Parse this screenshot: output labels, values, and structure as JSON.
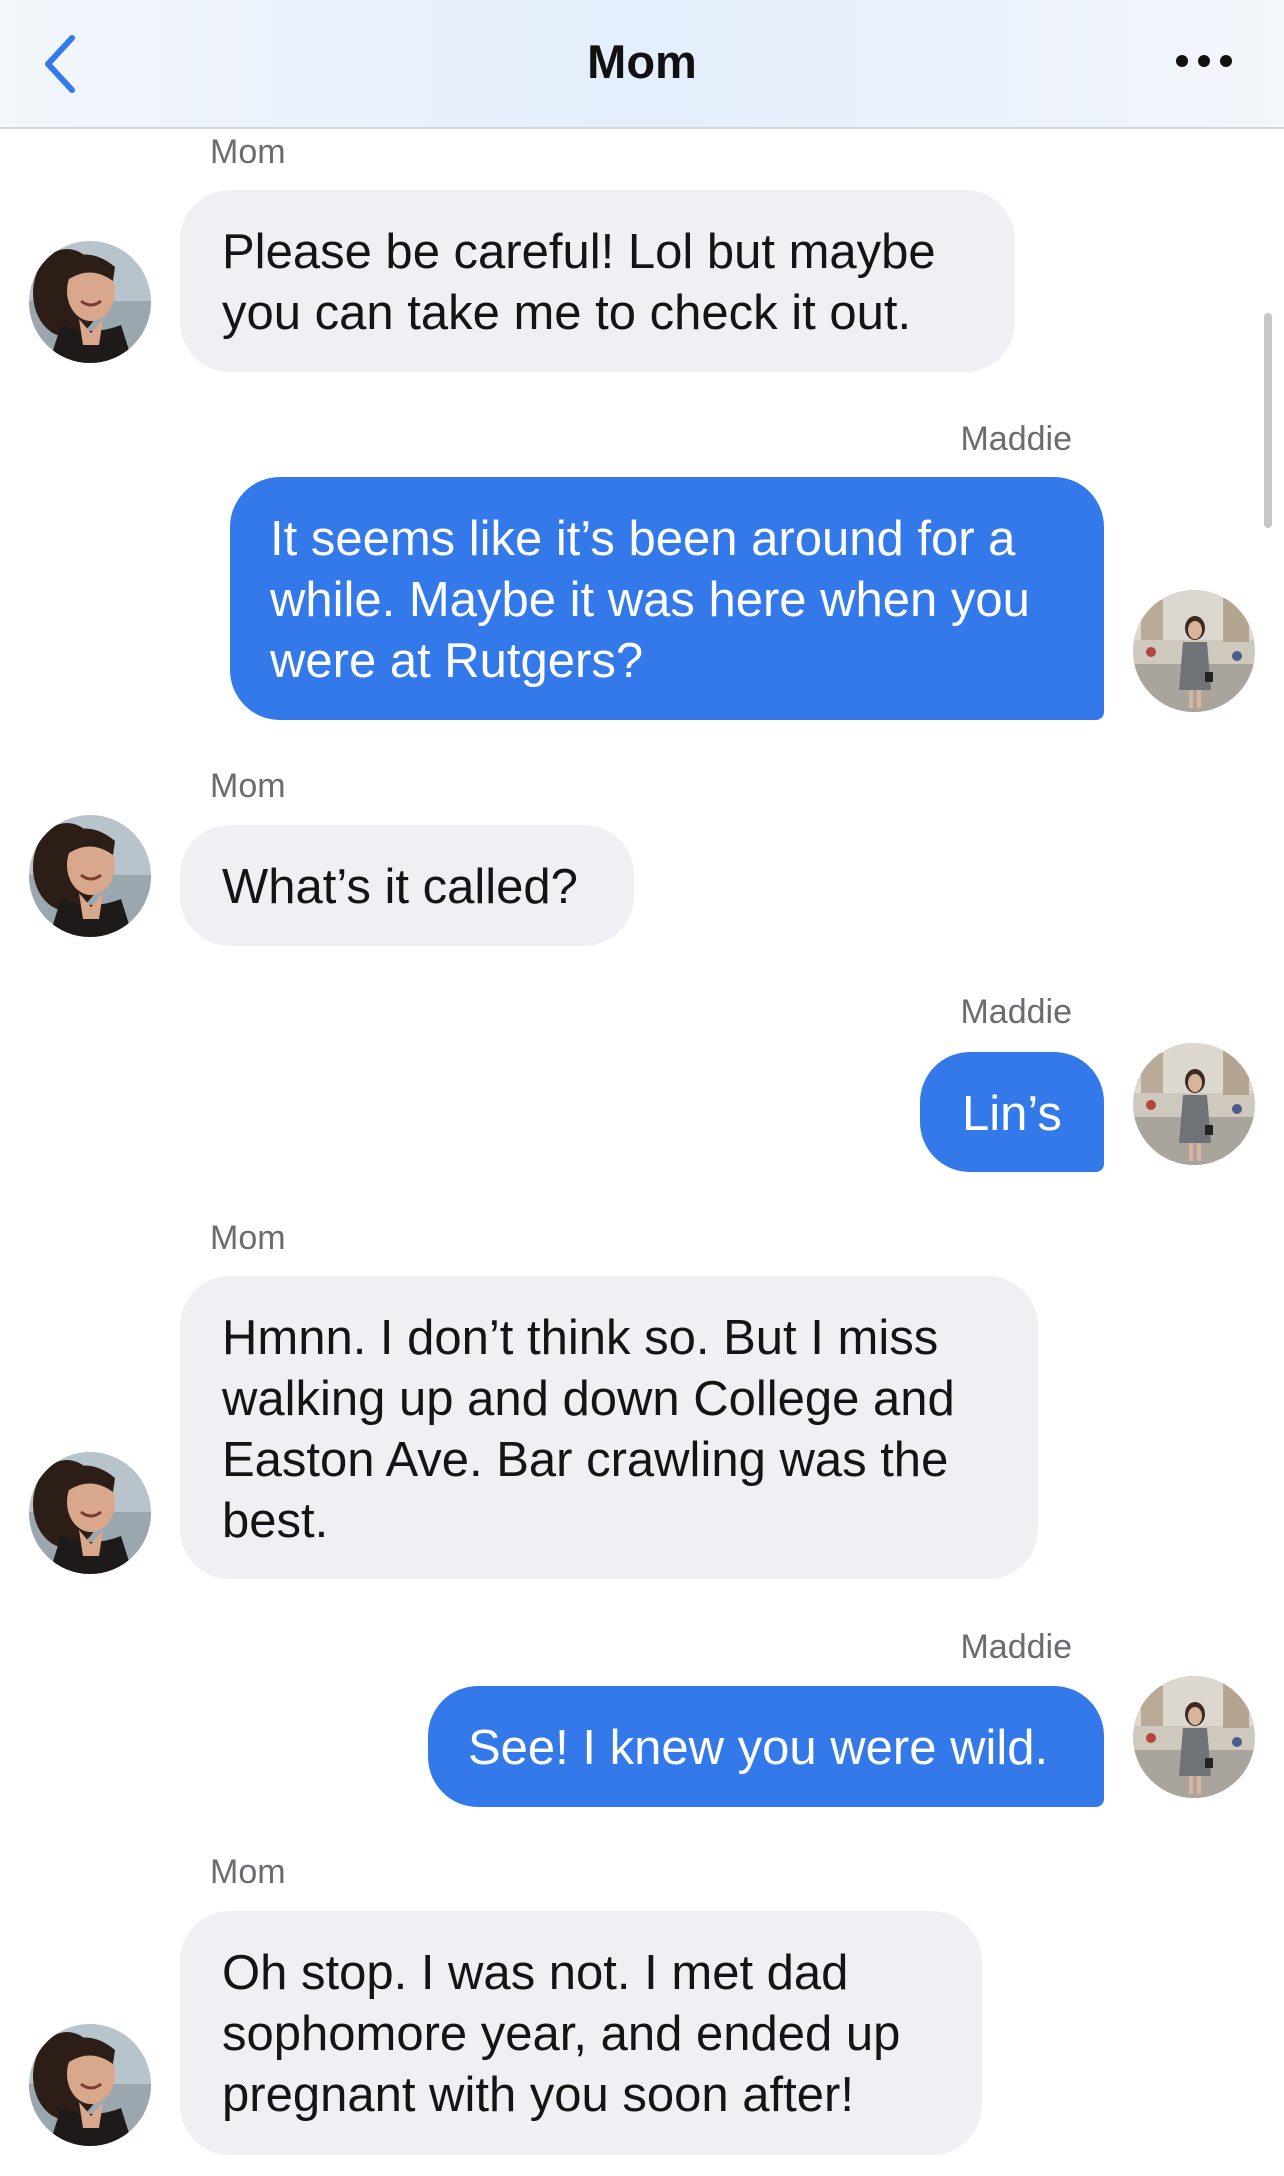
{
  "header": {
    "title": "Mom",
    "back_icon": "chevron-left-icon",
    "more_icon": "more-dots-icon",
    "accent_color": "#3479ea"
  },
  "messages": [
    {
      "sender": "Mom",
      "direction": "incoming",
      "text": "Please be careful! Lol but maybe you can take me to check it out."
    },
    {
      "sender": "Maddie",
      "direction": "outgoing",
      "text": "It seems like it’s been around for a while. Maybe it was here when you were at Rutgers?"
    },
    {
      "sender": "Mom",
      "direction": "incoming",
      "text": "What’s it called?"
    },
    {
      "sender": "Maddie",
      "direction": "outgoing",
      "text": "Lin’s"
    },
    {
      "sender": "Mom",
      "direction": "incoming",
      "text": "Hmnn. I don’t think so. But I miss walking up and down College and Easton Ave. Bar crawling was the best."
    },
    {
      "sender": "Maddie",
      "direction": "outgoing",
      "text": "See! I knew you were wild."
    },
    {
      "sender": "Mom",
      "direction": "incoming",
      "text": "Oh stop. I was not. I met dad sophomore year, and ended up pregnant with you soon after!"
    }
  ],
  "colors": {
    "incoming_bubble": "#f0f0f4",
    "outgoing_bubble": "#3479ea"
  }
}
